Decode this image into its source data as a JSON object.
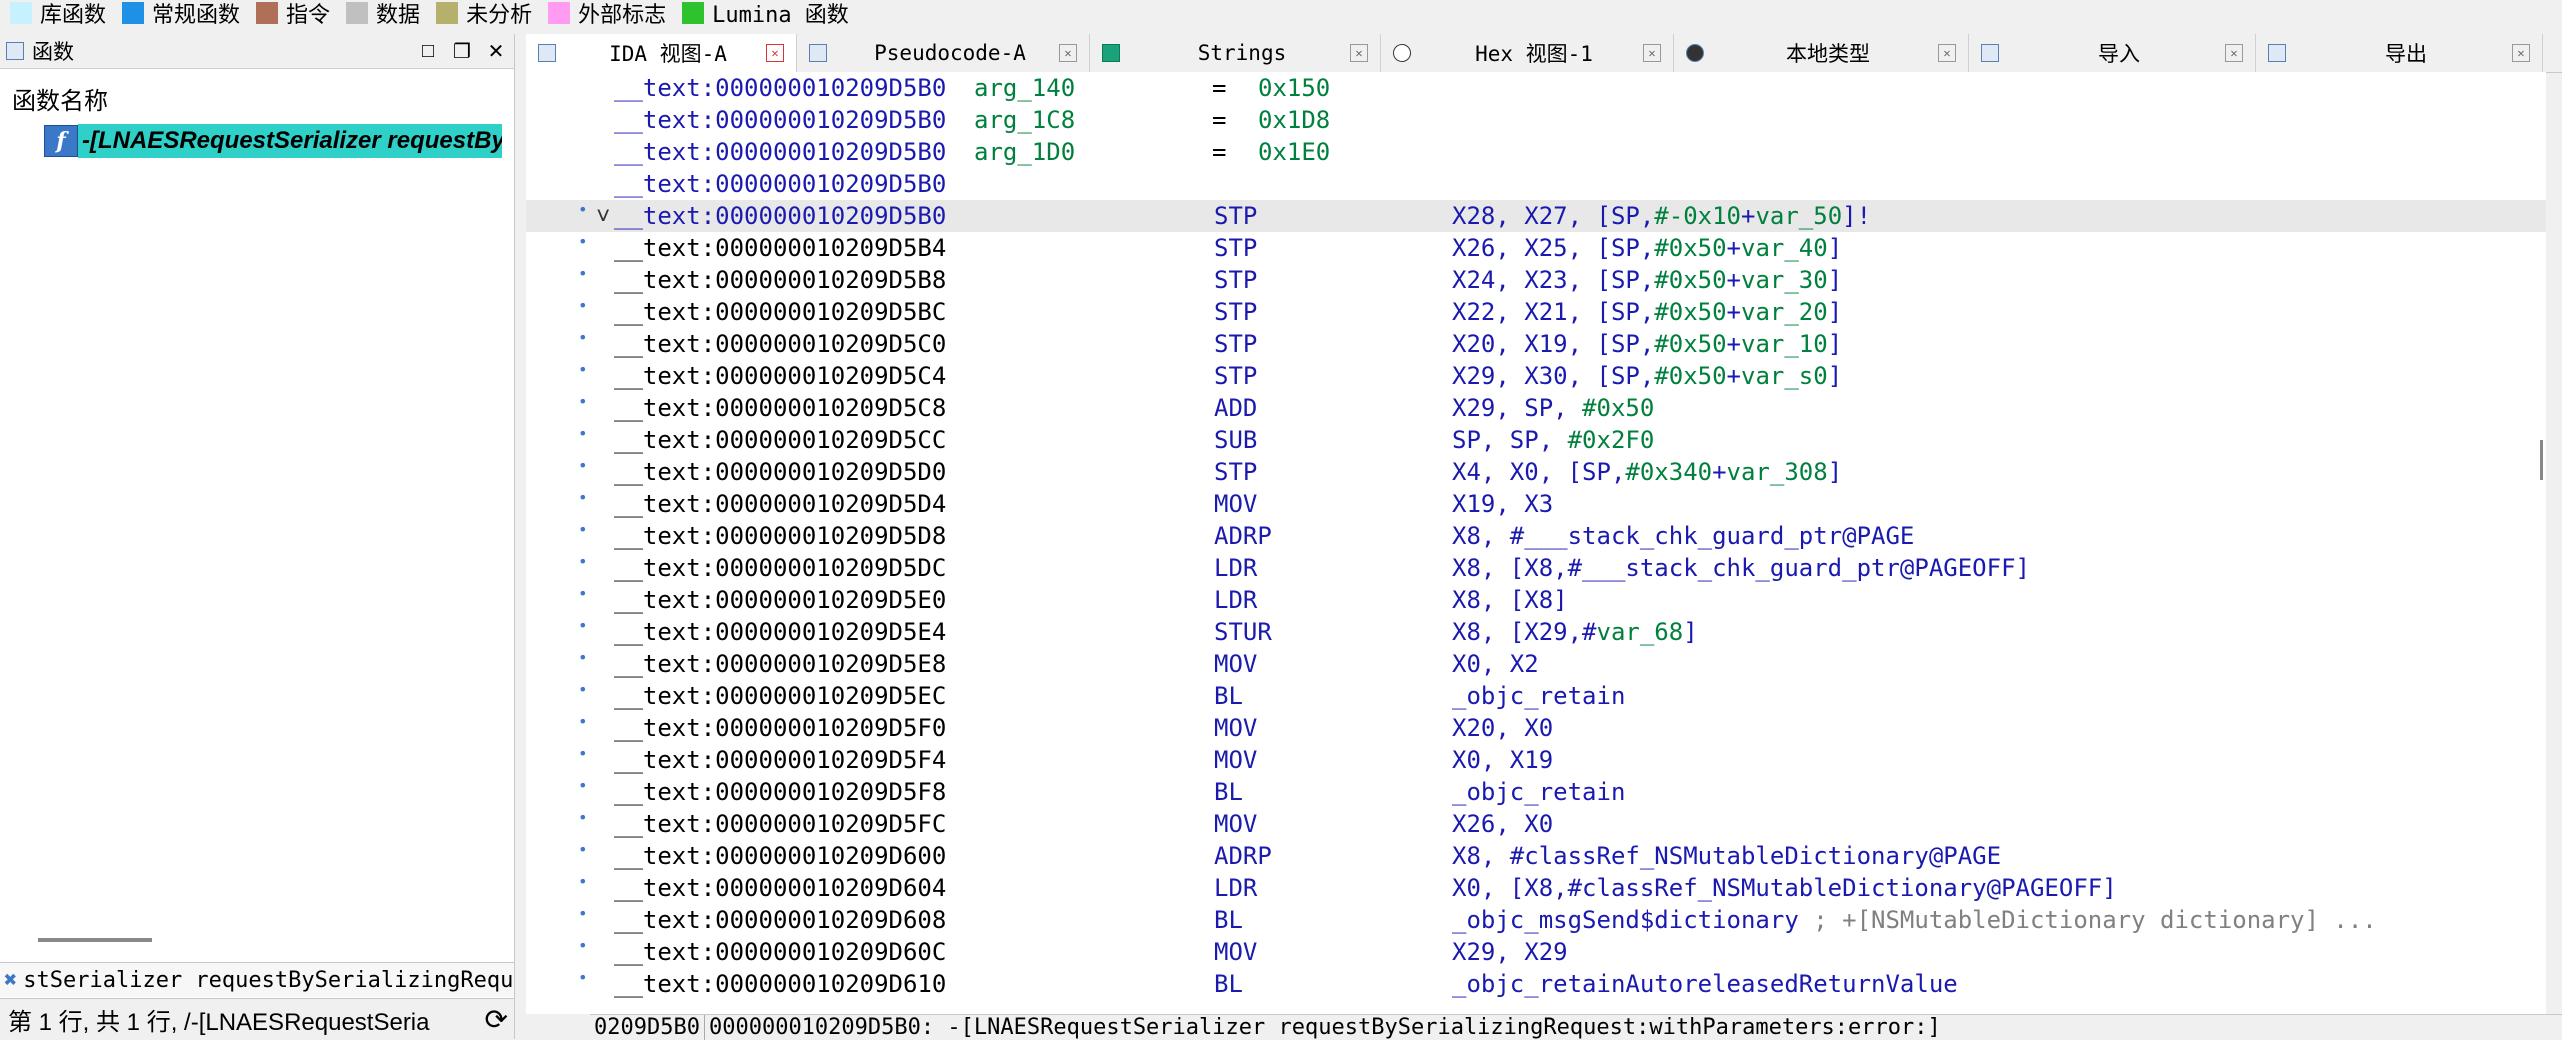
{
  "legend": [
    {
      "label": "库函数",
      "color": "#c6f2ff",
      "mono": false
    },
    {
      "label": "常规函数",
      "color": "#1e90e6",
      "mono": false
    },
    {
      "label": "指令",
      "color": "#b07057",
      "mono": false
    },
    {
      "label": "数据",
      "color": "#c0c0c0",
      "mono": false
    },
    {
      "label": "未分析",
      "color": "#b5b06c",
      "mono": false
    },
    {
      "label": "外部标志",
      "color": "#ff9cf2",
      "mono": false
    },
    {
      "label": "Lumina 函数",
      "color": "#2ec32e",
      "mono": true
    }
  ],
  "functions_panel": {
    "title": "函数",
    "column_header": "函数名称",
    "selected_function": "-[LNAESRequestSerializer requestBy",
    "func_icon": "f",
    "filter_text": "stSerializer requestBySerializingRequest",
    "status_text": "第 1 行, 共 1 行, /-[LNAESRequestSeria"
  },
  "tabs": [
    {
      "label": "IDA 视图-A",
      "icon": "ida-view-icon",
      "active": true
    },
    {
      "label": "Pseudocode-A",
      "icon": "pseudocode-icon",
      "active": false
    },
    {
      "label": "Strings",
      "icon": "strings-icon",
      "active": false
    },
    {
      "label": "Hex 视图-1",
      "icon": "hex-icon",
      "active": false
    },
    {
      "label": "本地类型",
      "icon": "local-types-icon",
      "active": false
    },
    {
      "label": "导入",
      "icon": "imports-icon",
      "active": false
    },
    {
      "label": "导出",
      "icon": "exports-icon",
      "active": false
    }
  ],
  "code_lines": [
    {
      "addr": "__text:000000010209D5B0",
      "kind": "equ",
      "name": "arg_140",
      "value": "0x150"
    },
    {
      "addr": "__text:000000010209D5B0",
      "kind": "equ",
      "name": "arg_1C8",
      "value": "0x1D8"
    },
    {
      "addr": "__text:000000010209D5B0",
      "kind": "equ",
      "name": "arg_1D0",
      "value": "0x1E0"
    },
    {
      "addr": "__text:000000010209D5B0",
      "kind": "blank"
    },
    {
      "addr": "__text:000000010209D5B0",
      "kind": "ins",
      "mn": "STP",
      "ops": "X28, X27, [SP,#-0x10+var_50]!",
      "current": true
    },
    {
      "addr": "__text:000000010209D5B4",
      "kind": "ins",
      "mn": "STP",
      "ops": "X26, X25, [SP,#0x50+var_40]"
    },
    {
      "addr": "__text:000000010209D5B8",
      "kind": "ins",
      "mn": "STP",
      "ops": "X24, X23, [SP,#0x50+var_30]"
    },
    {
      "addr": "__text:000000010209D5BC",
      "kind": "ins",
      "mn": "STP",
      "ops": "X22, X21, [SP,#0x50+var_20]"
    },
    {
      "addr": "__text:000000010209D5C0",
      "kind": "ins",
      "mn": "STP",
      "ops": "X20, X19, [SP,#0x50+var_10]"
    },
    {
      "addr": "__text:000000010209D5C4",
      "kind": "ins",
      "mn": "STP",
      "ops": "X29, X30, [SP,#0x50+var_s0]"
    },
    {
      "addr": "__text:000000010209D5C8",
      "kind": "ins",
      "mn": "ADD",
      "ops": "X29, SP, #0x50"
    },
    {
      "addr": "__text:000000010209D5CC",
      "kind": "ins",
      "mn": "SUB",
      "ops": "SP, SP, #0x2F0"
    },
    {
      "addr": "__text:000000010209D5D0",
      "kind": "ins",
      "mn": "STP",
      "ops": "X4, X0, [SP,#0x340+var_308]"
    },
    {
      "addr": "__text:000000010209D5D4",
      "kind": "ins",
      "mn": "MOV",
      "ops": "X19, X3"
    },
    {
      "addr": "__text:000000010209D5D8",
      "kind": "ins",
      "mn": "ADRP",
      "ops": "X8, #___stack_chk_guard_ptr@PAGE"
    },
    {
      "addr": "__text:000000010209D5DC",
      "kind": "ins",
      "mn": "LDR",
      "ops": "X8, [X8,#___stack_chk_guard_ptr@PAGEOFF]"
    },
    {
      "addr": "__text:000000010209D5E0",
      "kind": "ins",
      "mn": "LDR",
      "ops": "X8, [X8]"
    },
    {
      "addr": "__text:000000010209D5E4",
      "kind": "ins",
      "mn": "STUR",
      "ops": "X8, [X29,#var_68]"
    },
    {
      "addr": "__text:000000010209D5E8",
      "kind": "ins",
      "mn": "MOV",
      "ops": "X0, X2"
    },
    {
      "addr": "__text:000000010209D5EC",
      "kind": "ins",
      "mn": "BL",
      "ops": "_objc_retain"
    },
    {
      "addr": "__text:000000010209D5F0",
      "kind": "ins",
      "mn": "MOV",
      "ops": "X20, X0"
    },
    {
      "addr": "__text:000000010209D5F4",
      "kind": "ins",
      "mn": "MOV",
      "ops": "X0, X19"
    },
    {
      "addr": "__text:000000010209D5F8",
      "kind": "ins",
      "mn": "BL",
      "ops": "_objc_retain"
    },
    {
      "addr": "__text:000000010209D5FC",
      "kind": "ins",
      "mn": "MOV",
      "ops": "X26, X0"
    },
    {
      "addr": "__text:000000010209D600",
      "kind": "ins",
      "mn": "ADRP",
      "ops": "X8, #classRef_NSMutableDictionary@PAGE"
    },
    {
      "addr": "__text:000000010209D604",
      "kind": "ins",
      "mn": "LDR",
      "ops": "X0, [X8,#classRef_NSMutableDictionary@PAGEOFF]"
    },
    {
      "addr": "__text:000000010209D608",
      "kind": "ins",
      "mn": "BL",
      "ops": "_objc_msgSend$dictionary",
      "comment": "; +[NSMutableDictionary dictionary] ..."
    },
    {
      "addr": "__text:000000010209D60C",
      "kind": "ins",
      "mn": "MOV",
      "ops": "X29, X29"
    },
    {
      "addr": "__text:000000010209D610",
      "kind": "ins",
      "mn": "BL",
      "ops": "_objc_retainAutoreleasedReturnValue"
    }
  ],
  "bottom_status": {
    "left": "0209D5B0",
    "right": "000000010209D5B0: -[LNAESRequestSerializer requestBySerializingRequest:withParameters:error:]"
  },
  "colors": {
    "address_blue": "#1a1ab0",
    "name_green": "#00803c",
    "comment_gray": "#808080",
    "selected_cyan": "#2ed0c8"
  }
}
